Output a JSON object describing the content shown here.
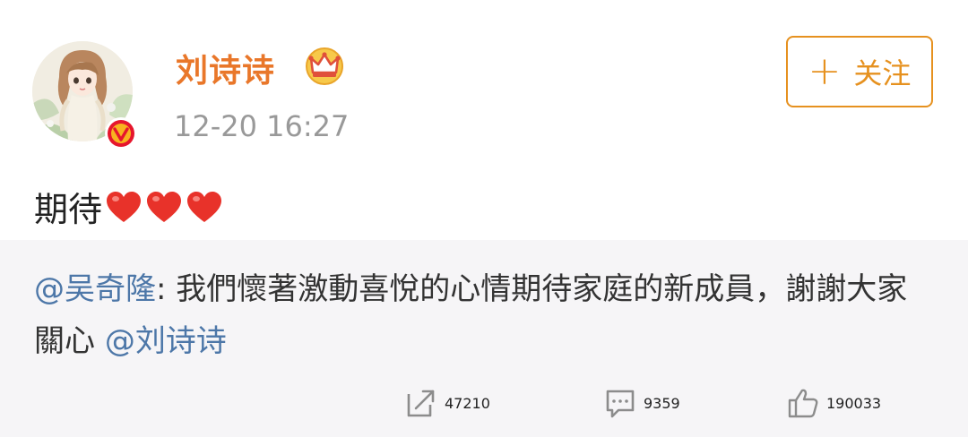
{
  "post": {
    "username": "刘诗诗",
    "timestamp": "12-20 16:27",
    "follow_label": "关注",
    "follow_plus": "+",
    "text": "期待",
    "emoji": [
      "heart",
      "heart",
      "heart"
    ]
  },
  "repost": {
    "mention_author": "@吴奇隆",
    "separator": ": ",
    "text": "我們懷著激動喜悅的心情期待家庭的新成員，謝謝大家關心 ",
    "mention_tail": "@刘诗诗"
  },
  "stats": {
    "reposts": "47210",
    "comments": "9359",
    "likes": "190033"
  },
  "colors": {
    "username": "#e9772a",
    "follow": "#e6911f",
    "mention": "#4d77a8",
    "repost_bg": "#f6f5f7",
    "heart": "#e8322a"
  },
  "icons": {
    "verified": "verified-v-icon",
    "crown": "crown-icon",
    "repost": "repost-icon",
    "comment": "comment-icon",
    "like": "thumbs-up-icon"
  }
}
